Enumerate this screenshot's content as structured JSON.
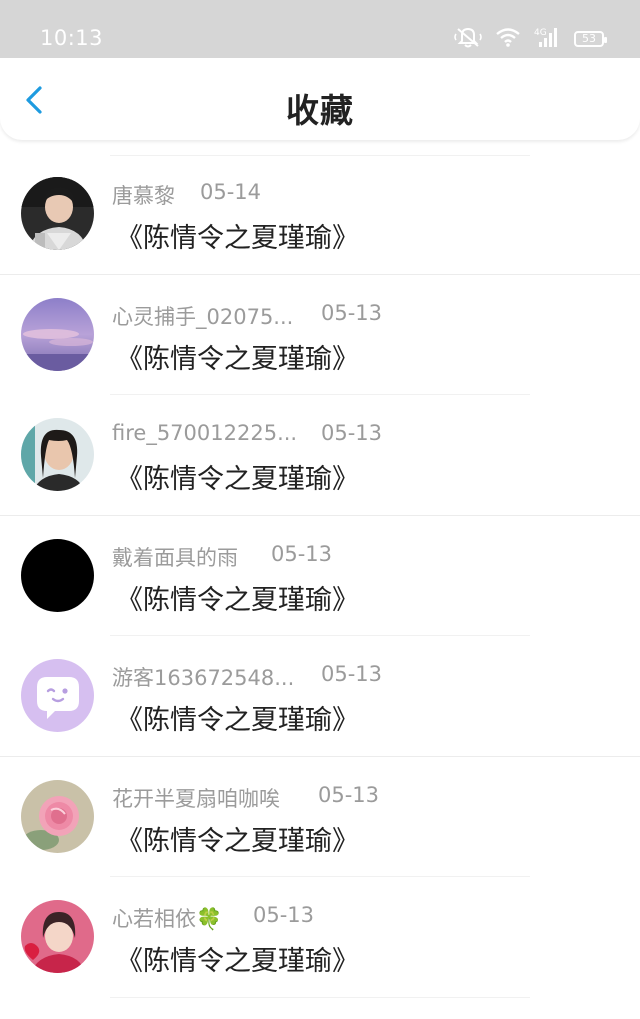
{
  "status_bar": {
    "time": "10:13",
    "battery": "53",
    "icons": [
      "mute-bell-icon",
      "wifi-icon",
      "signal-4g-icon",
      "battery-icon"
    ]
  },
  "header": {
    "title": "收藏",
    "back_icon": "chevron-left-icon",
    "accent_color": "#1e9be0"
  },
  "favorites": [
    {
      "user": "唐慕黎",
      "date": "05-14",
      "title": "《陈情令之夏瑾瑜》",
      "avatar": "photo-man"
    },
    {
      "user": "心灵捕手_02075...",
      "date": "05-13",
      "title": "《陈情令之夏瑾瑜》",
      "avatar": "purple-sky"
    },
    {
      "user": "fire_570012225...",
      "date": "05-13",
      "title": "《陈情令之夏瑾瑜》",
      "avatar": "photo-girl"
    },
    {
      "user": "戴着面具的雨",
      "date": "05-13",
      "title": "《陈情令之夏瑾瑜》",
      "avatar": "black-circle"
    },
    {
      "user": "游客163672548...",
      "date": "05-13",
      "title": "《陈情令之夏瑾瑜》",
      "avatar": "default-chat-face"
    },
    {
      "user": "花开半夏扇咱咖唉",
      "date": "05-13",
      "title": "《陈情令之夏瑾瑜》",
      "avatar": "pink-rose"
    },
    {
      "user": "心若相依🍀",
      "date": "05-13",
      "title": "《陈情令之夏瑾瑜》",
      "avatar": "photo-girl-red"
    }
  ]
}
